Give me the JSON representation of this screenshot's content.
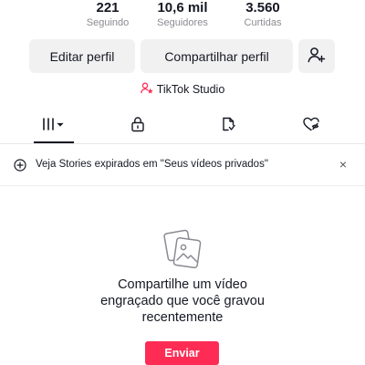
{
  "profile_stats": [
    {
      "value": "221",
      "label": "Seguindo"
    },
    {
      "value": "10,6 mil",
      "label": "Seguidores"
    },
    {
      "value": "3.560",
      "label": "Curtidas"
    }
  ],
  "actions": {
    "edit_profile": "Editar perfil",
    "share_profile": "Compartilhar perfil",
    "add_friends_icon": "add-user-icon"
  },
  "studio": {
    "label": "TikTok Studio",
    "icon": "person-star-icon",
    "icon_color": "#fe2c55"
  },
  "tabs": [
    {
      "icon": "grid-icon",
      "selected": true
    },
    {
      "icon": "lock-icon",
      "selected": false
    },
    {
      "icon": "repost-icon",
      "selected": false
    },
    {
      "icon": "liked-icon",
      "selected": false
    }
  ],
  "banner": {
    "icon": "add-circle-icon",
    "text": "Veja Stories expirados em \"Seus vídeos privados\"",
    "close": "×"
  },
  "empty_state": {
    "icon": "photos-icon",
    "message": "Compartilhe um vídeo engraçado que você gravou recentemente",
    "button": "Enviar"
  },
  "colors": {
    "accent": "#fe2c55",
    "text": "#161823",
    "muted": "#8a8b91",
    "button_bg": "#f1f1f2"
  }
}
